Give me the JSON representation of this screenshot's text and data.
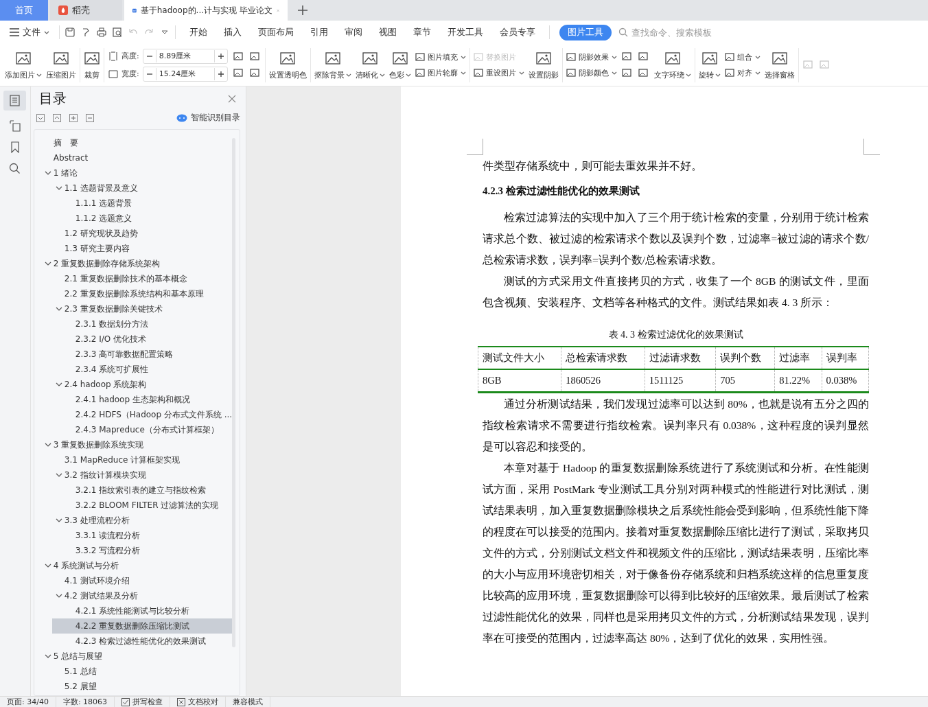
{
  "tabs": [
    {
      "kind": "home",
      "label": "首页",
      "selected": false
    },
    {
      "kind": "app",
      "label": "稻壳",
      "selected": false
    },
    {
      "kind": "doc",
      "label": "基于hadoop的...计与实现 毕业论文",
      "selected": true
    }
  ],
  "menu": {
    "file_label": "文件",
    "ribbon_tabs": [
      {
        "label": "开始",
        "selected": false
      },
      {
        "label": "插入",
        "selected": false
      },
      {
        "label": "页面布局",
        "selected": false
      },
      {
        "label": "引用",
        "selected": false
      },
      {
        "label": "审阅",
        "selected": false
      },
      {
        "label": "视图",
        "selected": false
      },
      {
        "label": "章节",
        "selected": false
      },
      {
        "label": "开发工具",
        "selected": false
      },
      {
        "label": "会员专享",
        "selected": false
      },
      {
        "label": "图片工具",
        "selected": true
      }
    ],
    "search_placeholder": "查找命令、搜索模板"
  },
  "ribbon": [
    {
      "kind": "big",
      "label": "添加图片",
      "dropdown": true
    },
    {
      "kind": "big",
      "label": "压缩图片",
      "dropdown": false
    },
    {
      "kind": "big",
      "label": "裁剪",
      "dropdown": false
    },
    {
      "kind": "size",
      "fields": [
        {
          "label": "高度:",
          "value": "8.89厘米"
        },
        {
          "label": "宽度:",
          "value": "15.24厘米"
        }
      ]
    },
    {
      "kind": "icons",
      "items": [
        {
          "disabled": false
        },
        {
          "disabled": false
        },
        {
          "disabled": false
        },
        {
          "disabled": false
        }
      ]
    },
    {
      "kind": "big",
      "label": "设置透明色",
      "dropdown": false
    },
    {
      "kind": "big",
      "label": "抠除背景",
      "dropdown": true
    },
    {
      "kind": "big",
      "label": "清晰化",
      "dropdown": true
    },
    {
      "kind": "big",
      "label": "色彩",
      "dropdown": true
    },
    {
      "kind": "small",
      "items": [
        {
          "label": "图片填充",
          "dropdown": true,
          "disabled": false
        },
        {
          "label": "图片轮廓",
          "dropdown": true,
          "disabled": false
        }
      ]
    },
    {
      "kind": "small",
      "items": [
        {
          "label": "替换图片",
          "dropdown": false,
          "disabled": true
        },
        {
          "label": "重设图片",
          "dropdown": true,
          "disabled": false
        }
      ]
    },
    {
      "kind": "big",
      "label": "设置阴影",
      "dropdown": false
    },
    {
      "kind": "small",
      "items": [
        {
          "label": "阴影效果",
          "dropdown": true,
          "disabled": false
        },
        {
          "label": "阴影颜色",
          "dropdown": true,
          "disabled": false
        }
      ]
    },
    {
      "kind": "icons",
      "items": [
        {
          "disabled": false
        },
        {
          "disabled": false
        },
        {
          "disabled": false
        },
        {
          "disabled": false
        }
      ]
    },
    {
      "kind": "big",
      "label": "文字环绕",
      "dropdown": true
    },
    {
      "kind": "big",
      "label": "旋转",
      "dropdown": true
    },
    {
      "kind": "small",
      "items": [
        {
          "label": "组合",
          "dropdown": true,
          "disabled": false
        },
        {
          "label": "对齐",
          "dropdown": true,
          "disabled": false
        }
      ]
    },
    {
      "kind": "big",
      "label": "选择窗格",
      "dropdown": false
    },
    {
      "kind": "icons",
      "items": [
        {
          "disabled": true
        },
        {
          "disabled": true
        }
      ]
    }
  ],
  "toc": {
    "title": "目录",
    "smart_label": "智能识别目录",
    "items": [
      {
        "label": "摘　要",
        "selected": false
      },
      {
        "label": "Abstract",
        "selected": false
      },
      {
        "label": "1  绪论",
        "selected": false,
        "expanded": true,
        "children": [
          {
            "label": "1.1 选题背景及意义",
            "selected": false,
            "expanded": true,
            "children": [
              {
                "label": "1.1.1 选题背景",
                "selected": false
              },
              {
                "label": "1.1.2 选题意义",
                "selected": false
              }
            ]
          },
          {
            "label": "1.2 研究现状及趋势",
            "selected": false
          },
          {
            "label": "1.3 研究主要内容",
            "selected": false
          }
        ]
      },
      {
        "label": "2  重复数据删除存储系统架构",
        "selected": false,
        "expanded": true,
        "children": [
          {
            "label": "2.1  重复数据删除技术的基本概念",
            "selected": false
          },
          {
            "label": "2.2  重复数据删除系统结构和基本原理",
            "selected": false
          },
          {
            "label": "2.3  重复数据删除关键技术",
            "selected": false,
            "expanded": true,
            "children": [
              {
                "label": "2.3.1  数据划分方法",
                "selected": false
              },
              {
                "label": "2.3.2 I/O 优化技术",
                "selected": false
              },
              {
                "label": "2.3.3  高可靠数据配置策略",
                "selected": false
              },
              {
                "label": "2.3.4  系统可扩展性",
                "selected": false
              }
            ]
          },
          {
            "label": "2.4 hadoop 系统架构",
            "selected": false,
            "expanded": true,
            "children": [
              {
                "label": "2.4.1 hadoop 生态架构和概况",
                "selected": false
              },
              {
                "label": "2.4.2 HDFS（Hadoop 分布式文件系统 ...",
                "selected": false
              },
              {
                "label": "2.4.3 Mapreduce（分布式计算框架）",
                "selected": false
              }
            ]
          }
        ]
      },
      {
        "label": "3  重复数据删除系统实现",
        "selected": false,
        "expanded": true,
        "children": [
          {
            "label": "3.1 MapReduce 计算框架实现",
            "selected": false
          },
          {
            "label": "3.2 指纹计算模块实现",
            "selected": false,
            "expanded": true,
            "children": [
              {
                "label": "3.2.1  指纹索引表的建立与指纹检索",
                "selected": false
              },
              {
                "label": "3.2.2 BLOOM FILTER 过滤算法的实现",
                "selected": false
              }
            ]
          },
          {
            "label": "3.3 处理流程分析",
            "selected": false,
            "expanded": true,
            "children": [
              {
                "label": "3.3.1 读流程分析",
                "selected": false
              },
              {
                "label": "3.3.2  写流程分析",
                "selected": false
              }
            ]
          }
        ]
      },
      {
        "label": "4 系统测试与分析",
        "selected": false,
        "expanded": true,
        "children": [
          {
            "label": "4.1  测试环境介绍",
            "selected": false
          },
          {
            "label": "4.2  测试结果及分析",
            "selected": false,
            "expanded": true,
            "children": [
              {
                "label": "4.2.1  系统性能测试与比较分析",
                "selected": false
              },
              {
                "label": "4.2.2  重复数据删除压缩比测试",
                "selected": true
              },
              {
                "label": "4.2.3  检索过滤性能优化的效果测试",
                "selected": false
              }
            ]
          }
        ]
      },
      {
        "label": "5  总结与展望",
        "selected": false,
        "expanded": true,
        "children": [
          {
            "label": "5.1  总结",
            "selected": false
          },
          {
            "label": "5.2  展望",
            "selected": false
          }
        ]
      }
    ]
  },
  "document": {
    "blocks": [
      {
        "kind": "para",
        "indent": false,
        "text": "件类型存储系统中，则可能去重效果并不好。"
      },
      {
        "kind": "heading",
        "text": "4.2.3  检索过滤性能优化的效果测试"
      },
      {
        "kind": "para",
        "indent": true,
        "text": "检索过滤算法的实现中加入了三个用于统计检索的变量，分别用于统计检索请求总个数、被过滤的检索请求个数以及误判个数，过滤率=被过滤的请求个数/总检索请求数，误判率=误判个数/总检索请求数。"
      },
      {
        "kind": "para",
        "indent": true,
        "text": "测试的方式采用文件直接拷贝的方式，收集了一个 8GB 的测试文件，里面包含视频、安装程序、文档等各种格式的文件。测试结果如表 4. 3 所示："
      },
      {
        "kind": "table",
        "caption": "表 4. 3 检索过滤优化的效果测试",
        "columns": [
          "测试文件大小",
          "总检索请求数",
          "过滤请求数",
          "误判个数",
          "过滤率",
          "误判率"
        ],
        "rows": [
          [
            "8GB",
            "1860526",
            "1511125",
            "705",
            "81.22%",
            "0.038%"
          ]
        ]
      },
      {
        "kind": "para",
        "indent": true,
        "text": "通过分析测试结果，我们发现过滤率可以达到 80%，也就是说有五分之四的指纹检索请求不需要进行指纹检索。误判率只有 0.038%，这种程度的误判显然是可以容忍和接受的。"
      },
      {
        "kind": "para",
        "indent": true,
        "text": "本章对基于 Hadoop 的重复数据删除系统进行了系统测试和分析。在性能测试方面，采用 PostMark 专业测试工具分别对两种模式的性能进行对比测试，测试结果表明，加入重复数据删除模块之后系统性能会受到影响，但系统性能下降的程度在可以接受的范围内。接着对重复数据删除压缩比进行了测试，采取拷贝文件的方式，分别测试文档文件和视频文件的压缩比，测试结果表明，压缩比率的大小与应用环境密切相关，对于像备份存储系统和归档系统这样的信息重复度比较高的应用环境，重复数据删除可以得到比较好的压缩效果。最后测试了检索过滤性能优化的效果，同样也是采用拷贝文件的方式，分析测试结果发现，误判率在可接受的范围内，过滤率高达 80%，达到了优化的效果，实用性强。"
      }
    ]
  },
  "status_bar": [
    {
      "kind": "text",
      "label": "页面: 34/40"
    },
    {
      "kind": "text",
      "label": "字数: 18063"
    },
    {
      "kind": "check",
      "label": "拼写检查",
      "checked": true
    },
    {
      "kind": "check",
      "label": "文档校对",
      "checked": false
    },
    {
      "kind": "text",
      "label": "兼容模式"
    }
  ]
}
